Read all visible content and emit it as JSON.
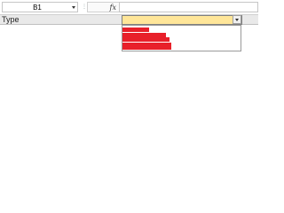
{
  "formula_bar": {
    "name_box_value": "B1",
    "fx_label": "fx",
    "formula_value": ""
  },
  "sheet": {
    "cell_a1": "Type",
    "active_cell_value": "",
    "active_cell_fill": "#ffe699"
  },
  "dropdown": {
    "item_color": "#e8202a",
    "items": [
      {
        "label": ""
      },
      {
        "label": ""
      },
      {
        "label": ""
      },
      {
        "label": ""
      },
      {
        "label": ""
      }
    ]
  }
}
